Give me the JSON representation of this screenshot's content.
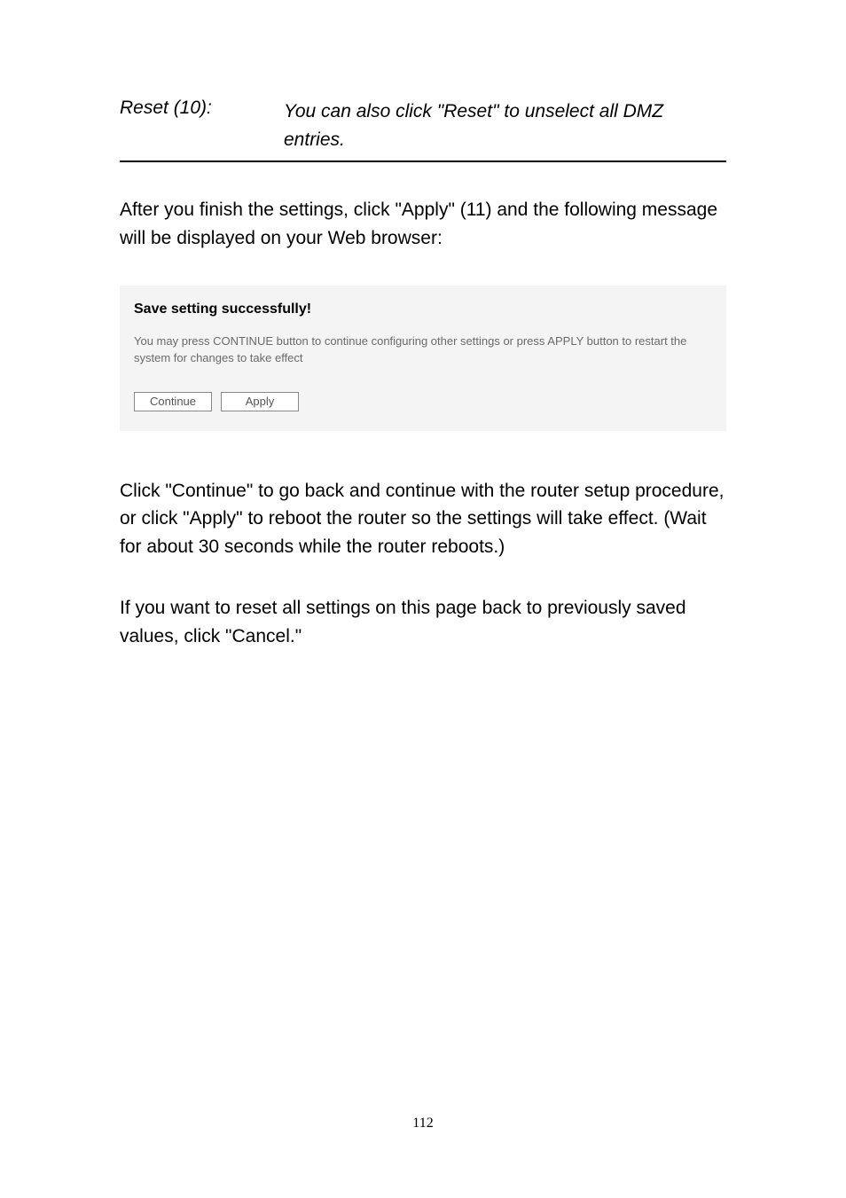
{
  "reset": {
    "label": "Reset (10):",
    "description": "You can also click \"Reset\" to unselect all DMZ entries."
  },
  "paragraph1": "After you finish the settings, click \"Apply\" (11) and the following message will be displayed on your Web browser:",
  "savePanel": {
    "title": "Save setting successfully!",
    "description": "You may press CONTINUE button to continue configuring other settings or press APPLY button to restart the system for changes to take effect",
    "continueLabel": "Continue",
    "applyLabel": "Apply"
  },
  "paragraph2": "Click \"Continue\" to go back and continue with the router setup procedure, or click \"Apply\" to reboot the router so the settings will take effect. (Wait for about 30 seconds while the router reboots.)",
  "paragraph3": "If you want to reset all settings on this page back to previously saved values, click \"Cancel.\"",
  "pageNumber": "112"
}
